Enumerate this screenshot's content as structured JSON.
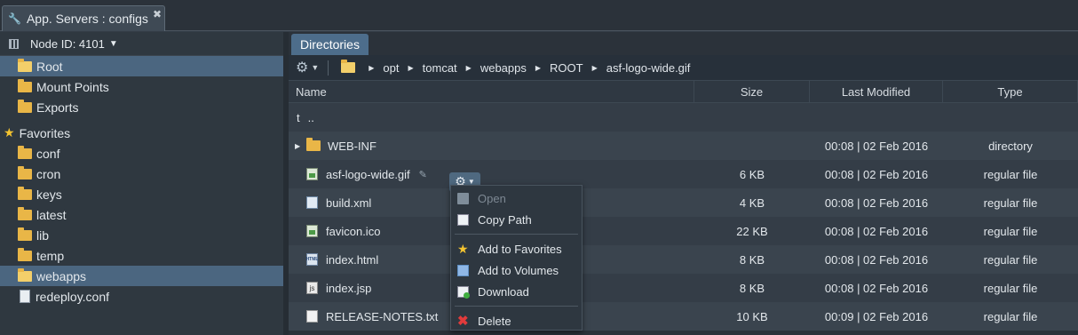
{
  "window": {
    "tab_title": "App. Servers : configs",
    "close_glyph": "✖"
  },
  "sidebar": {
    "node_label": "Node ID: 4101",
    "items": [
      {
        "label": "Root",
        "icon": "folder-open-icon",
        "selected": true
      },
      {
        "label": "Mount Points",
        "icon": "mount-folder-icon"
      },
      {
        "label": "Exports",
        "icon": "export-folder-icon"
      }
    ],
    "favorites_label": "Favorites",
    "favorites": [
      {
        "label": "conf",
        "icon": "folder-icon"
      },
      {
        "label": "cron",
        "icon": "folder-icon"
      },
      {
        "label": "keys",
        "icon": "folder-icon"
      },
      {
        "label": "latest",
        "icon": "folder-icon"
      },
      {
        "label": "lib",
        "icon": "folder-icon"
      },
      {
        "label": "temp",
        "icon": "folder-icon"
      },
      {
        "label": "webapps",
        "icon": "folder-open-icon",
        "selected": true
      },
      {
        "label": "redeploy.conf",
        "icon": "file-icon"
      }
    ]
  },
  "main": {
    "tab_label": "Directories",
    "breadcrumb": [
      "opt",
      "tomcat",
      "webapps",
      "ROOT",
      "asf-logo-wide.gif"
    ],
    "columns": {
      "name": "Name",
      "size": "Size",
      "modified": "Last Modified",
      "type": "Type"
    },
    "parent_row": {
      "glyph": "t",
      "label": ".."
    },
    "rows": [
      {
        "name": "WEB-INF",
        "icon": "folder-icon",
        "size": "",
        "modified": "00:08 | 02 Feb 2016",
        "type": "directory"
      },
      {
        "name": "asf-logo-wide.gif",
        "icon": "image-file-icon",
        "size": "6 KB",
        "modified": "00:08 | 02 Feb 2016",
        "type": "regular file"
      },
      {
        "name": "build.xml",
        "icon": "xml-file-icon",
        "size": "4 KB",
        "modified": "00:08 | 02 Feb 2016",
        "type": "regular file"
      },
      {
        "name": "favicon.ico",
        "icon": "image-file-icon",
        "size": "22 KB",
        "modified": "00:08 | 02 Feb 2016",
        "type": "regular file"
      },
      {
        "name": "index.html",
        "icon": "html-file-icon",
        "size": "8 KB",
        "modified": "00:08 | 02 Feb 2016",
        "type": "regular file"
      },
      {
        "name": "index.jsp",
        "icon": "jsp-file-icon",
        "size": "8 KB",
        "modified": "00:08 | 02 Feb 2016",
        "type": "regular file"
      },
      {
        "name": "RELEASE-NOTES.txt",
        "icon": "text-file-icon",
        "size": "10 KB",
        "modified": "00:09 | 02 Feb 2016",
        "type": "regular file"
      }
    ],
    "html_icon_text": "HTML",
    "jsp_icon_text": "js"
  },
  "context_menu": {
    "open": "Open",
    "copy_path": "Copy Path",
    "add_favorites": "Add to Favorites",
    "add_volumes": "Add to Volumes",
    "download": "Download",
    "delete": "Delete"
  }
}
